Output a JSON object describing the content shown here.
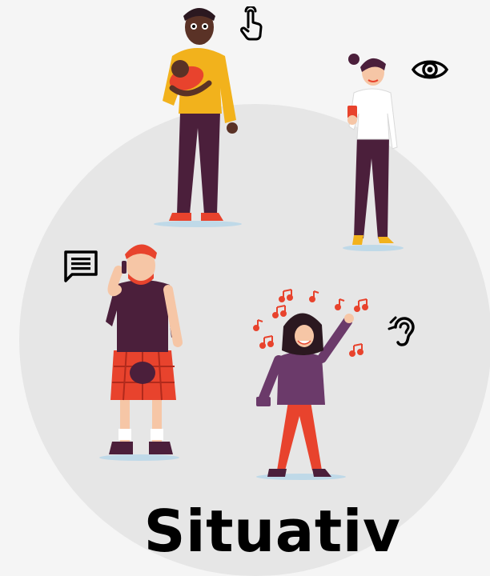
{
  "title": "Situativ",
  "icons": {
    "touch": "touch-icon",
    "visual": "eye-icon",
    "speech": "message-icon",
    "hearing": "ear-icon"
  },
  "colors": {
    "circle_bg": "#e6e6e6",
    "page_bg": "#f5f5f5",
    "hoodie": "#f2b21c",
    "dark_clothes": "#4b1f3b",
    "red_accent": "#e8432d",
    "skin_dark": "#5a3226",
    "skin_light": "#f6c6a6"
  }
}
